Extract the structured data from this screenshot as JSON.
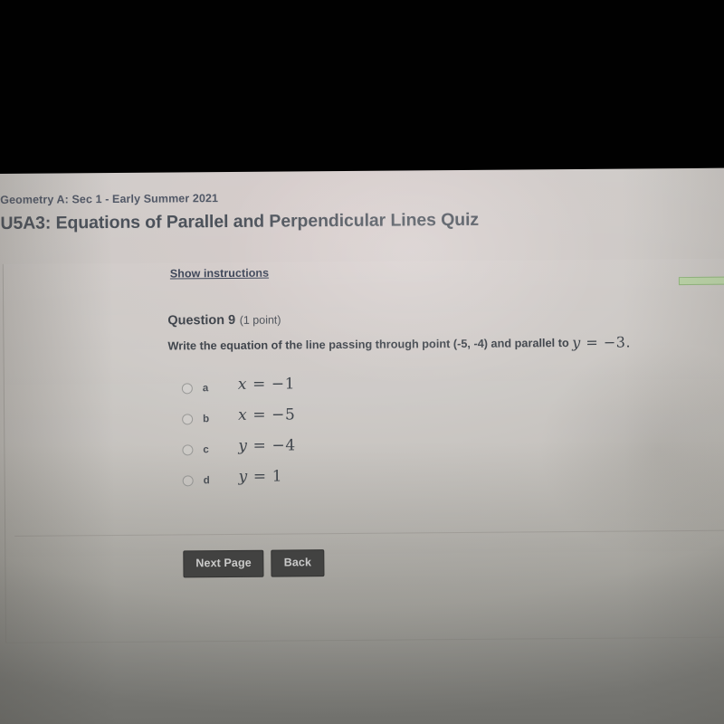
{
  "header": {
    "course": "Geometry A: Sec 1 - Early Summer 2021",
    "quiz_title": "U5A3: Equations of Parallel and Perpendicular Lines Quiz"
  },
  "content": {
    "show_instructions_label": "Show instructions",
    "question_number_label": "Question 9",
    "question_points_label": "(1 point)",
    "question_text_prefix": "Write the equation of the line passing through point (-5, -4) and parallel to",
    "question_math_var": "y",
    "question_math_rest": " = −3.",
    "options": [
      {
        "letter": "a",
        "math_var": "x",
        "math_rest": " = −1",
        "selected": false
      },
      {
        "letter": "b",
        "math_var": "x",
        "math_rest": " = −5",
        "selected": false
      },
      {
        "letter": "c",
        "math_var": "y",
        "math_rest": " = −4",
        "selected": false
      },
      {
        "letter": "d",
        "math_var": "y",
        "math_rest": " = 1",
        "selected": false
      }
    ]
  },
  "footer": {
    "next_page_label": "Next Page",
    "back_label": "Back"
  },
  "colors": {
    "link": "#3d4558",
    "title": "#464c55",
    "button_bg": "#414141",
    "progress_green": "#b9d3a4",
    "screen_bg": "#cdc9c6",
    "letterbox": "#010101"
  }
}
